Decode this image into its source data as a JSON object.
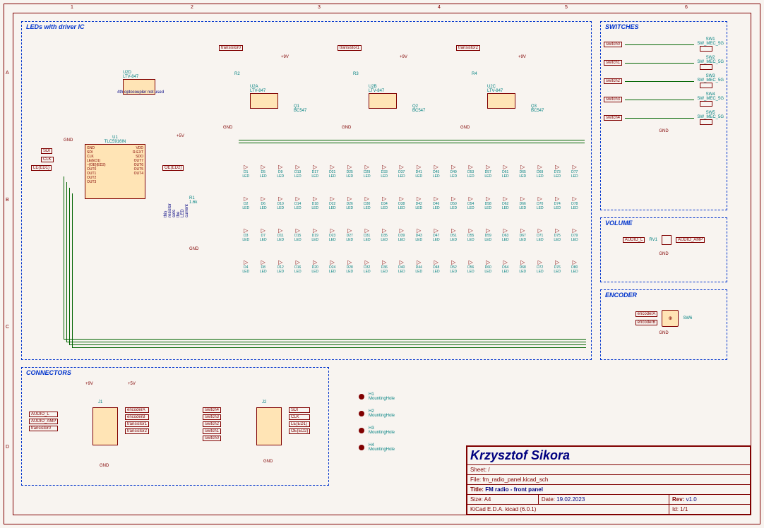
{
  "blocks": {
    "leds": {
      "title": "LEDs with driver IC"
    },
    "switches": {
      "title": "SWITCHES"
    },
    "volume": {
      "title": "VOLUME"
    },
    "encoder": {
      "title": "ENCODER"
    },
    "connectors": {
      "title": "CONNECTORS"
    }
  },
  "titleblock": {
    "author": "Krzysztof Sikora",
    "sheet": "Sheet: /",
    "file": "File: fm_radio_panel.kicad_sch",
    "title_label": "Title:",
    "title": "FM radio - front panel",
    "size_label": "Size: A4",
    "date_label": "Date:",
    "date": "19.02.2023",
    "rev_label": "Rev:",
    "rev": "v1.0",
    "tool": "KiCad E.D.A.  kicad (6.0.1)",
    "id": "Id: 1/1"
  },
  "components": {
    "u1": {
      "ref": "U1",
      "value": "TLC5916IN"
    },
    "u1_pins": [
      "GND",
      "SDI",
      "CLK",
      "LE(ED1)",
      "~{OE}(ED2)",
      "OUT0",
      "OUT1",
      "OUT2",
      "OUT3",
      "VDD",
      "R-EXT",
      "SDO",
      "OUT7",
      "OUT6",
      "OUT5",
      "OUT4"
    ],
    "u2a": {
      "ref": "U2A",
      "value": "LTV-847"
    },
    "u2b": {
      "ref": "U2B",
      "value": "LTV-847"
    },
    "u2c": {
      "ref": "U2C",
      "value": "LTV-847"
    },
    "u2d": {
      "ref": "U2D",
      "value": "LTV-847"
    },
    "u2d_note": "4th optocoupler not used",
    "q1": {
      "ref": "Q1",
      "value": "BC547"
    },
    "q2": {
      "ref": "Q2",
      "value": "BC547"
    },
    "q3": {
      "ref": "Q3",
      "value": "BC547"
    },
    "r1": {
      "ref": "R1",
      "value": "1.6k"
    },
    "r1_note": "this resistor sets the LED current",
    "r2": {
      "ref": "R2"
    },
    "r3": {
      "ref": "R3"
    },
    "r4": {
      "ref": "R4"
    },
    "rv1": {
      "ref": "RV1"
    },
    "j1": {
      "ref": "J1"
    },
    "j2": {
      "ref": "J2"
    },
    "sw1": {
      "ref": "SW1",
      "value": "SW_MEC_5G"
    },
    "sw2": {
      "ref": "SW2",
      "value": "SW_MEC_5G"
    },
    "sw3": {
      "ref": "SW3",
      "value": "SW_MEC_5G"
    },
    "sw4": {
      "ref": "SW4",
      "value": "SW_MEC_5G"
    },
    "sw5": {
      "ref": "SW5",
      "value": "SW_MEC_5G"
    },
    "sw6": {
      "ref": "SW6"
    }
  },
  "power": {
    "p9v": "+9V",
    "p5v": "+5V",
    "gnd": "GND"
  },
  "netlabels": {
    "transistor0": "transistor0",
    "transistor1": "transistor1",
    "transistor2": "transistor2",
    "sdi": "SDI",
    "clk": "CLK",
    "le": "LE(ED1)",
    "oe": "OE(ED2)",
    "switch0": "switch0",
    "switch1": "switch1",
    "switch2": "switch2",
    "switch3": "switch3",
    "switch4": "switch4",
    "audio_l": "AUDIO_L",
    "audio_amp": "AUDIO_AMP",
    "encoderA": "encoderA",
    "encoderB": "encoderB"
  },
  "connectors": {
    "j1_left": [
      "AUDIO_L",
      "AUDIO_AMP",
      "transistor0"
    ],
    "j1_right": [
      "encoderA",
      "encoderB",
      "transistor1",
      "transistor2"
    ],
    "j2_left": [
      "switch4",
      "switch3",
      "switch2",
      "switch1",
      "switch0"
    ],
    "j2_right": [
      "SDI",
      "CLK",
      "LE(ED1)",
      "OE(ED2)"
    ]
  },
  "holes": {
    "h1": "H1",
    "h2": "H2",
    "h3": "H3",
    "h4": "H4",
    "label": "MountingHole"
  },
  "leds": {
    "rows": [
      [
        "D1",
        "D5",
        "D9",
        "D13",
        "D17",
        "D21",
        "D25",
        "D29",
        "D33",
        "D37",
        "D41",
        "D45",
        "D49",
        "D53",
        "D57",
        "D61",
        "D65",
        "D69",
        "D73",
        "D77"
      ],
      [
        "D2",
        "D6",
        "D10",
        "D14",
        "D18",
        "D22",
        "D26",
        "D30",
        "D34",
        "D38",
        "D42",
        "D46",
        "D50",
        "D54",
        "D58",
        "D62",
        "D66",
        "D70",
        "D74",
        "D78"
      ],
      [
        "D3",
        "D7",
        "D11",
        "D15",
        "D19",
        "D23",
        "D27",
        "D31",
        "D35",
        "D39",
        "D43",
        "D47",
        "D51",
        "D55",
        "D59",
        "D63",
        "D67",
        "D71",
        "D75",
        "D79"
      ],
      [
        "D4",
        "D8",
        "D12",
        "D16",
        "D20",
        "D24",
        "D28",
        "D32",
        "D36",
        "D40",
        "D44",
        "D48",
        "D52",
        "D56",
        "D60",
        "D64",
        "D68",
        "D72",
        "D76",
        "D80"
      ]
    ],
    "val": "LED"
  },
  "ruler": {
    "top": [
      "1",
      "2",
      "3",
      "4",
      "5",
      "6"
    ],
    "side": [
      "A",
      "B",
      "C",
      "D"
    ]
  }
}
